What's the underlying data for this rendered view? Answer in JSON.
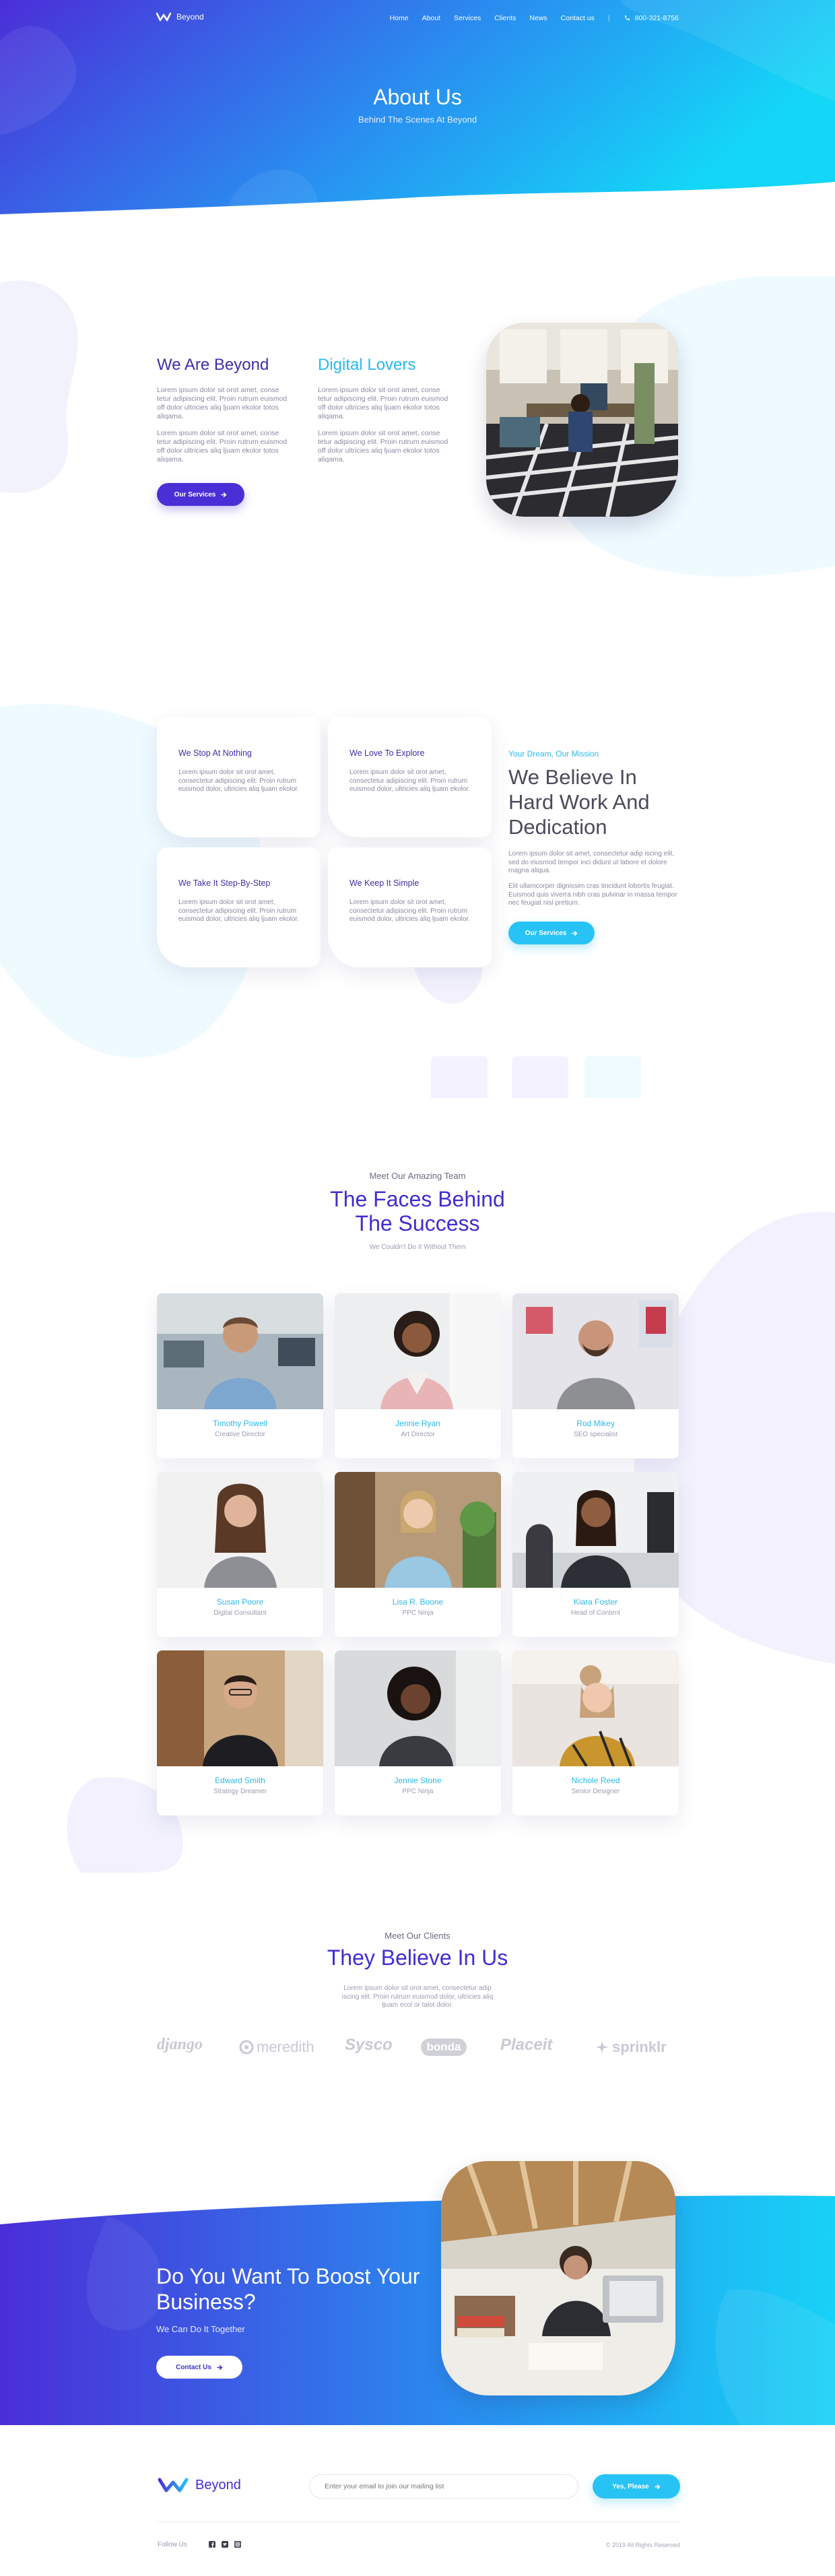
{
  "nav": {
    "logo_text": "Beyond",
    "links": [
      "Home",
      "About",
      "Services",
      "Clients",
      "News",
      "Contact us"
    ],
    "phone": "800-321-8756"
  },
  "hero": {
    "title": "About Us",
    "subtitle": "Behind The Scenes At Beyond"
  },
  "about": {
    "left_title": "We Are Beyond",
    "right_title": "Digital Lovers",
    "paragraph": "Lorem ipsum dolor sit orot amet, conse tetur adipiscing elit. Proin rutrum euismod off dolor ultricies aliq ljuam ekolor totos aliqama.",
    "button": "Our Services"
  },
  "features": {
    "cards": [
      {
        "title": "We Stop At Nothing",
        "text": "Lorem ipsum dolor sit orot amet, consectetur adipiscing elit. Proin rutrum euismod dolor, ultricies aliq ljuam ekolor."
      },
      {
        "title": "We Love To Explore",
        "text": "Lorem ipsum dolor sit orot amet, consectetur adipiscing elit. Proin rutrum euismod dolor, ultricies aliq ljuam ekolor."
      },
      {
        "title": "We Take It Step-By-Step",
        "text": "Lorem ipsum dolor sit orot amet, consectetur adipiscing elit. Proin rutrum euismod dolor, ultricies aliq ljuam ekolor."
      },
      {
        "title": "We Keep It Simple",
        "text": "Lorem ipsum dolor sit orot amet, consectetur adipiscing elit. Proin rutrum euismod dolor, ultricies aliq ljuam ekolor."
      }
    ],
    "kicker": "Your Dream, Our Mission",
    "title": "We Believe In Hard Work And Dedication",
    "paragraph1": "Lorem ipsum dolor sit amet, consectetur adip iscing elit, sed do eiusmod tempor inci didunt ut labore et dolore magna aliqua.",
    "paragraph2": "Elit ullamcorper dignissim cras tincidunt lobortis feugiat. Euismod quis viverra nibh cras pulvinar in massa tempor nec feugiat nisl pretium.",
    "button": "Our Services"
  },
  "team": {
    "kicker": "Meet Our Amazing Team",
    "title": "The Faces Behind The Success",
    "subtitle": "We Couldn't Do It Without Them",
    "members": [
      {
        "name": "Timothy Powell",
        "role": "Creative Director"
      },
      {
        "name": "Jennie Ryan",
        "role": "Art Director"
      },
      {
        "name": "Rod Mikey",
        "role": "SEO specialist"
      },
      {
        "name": "Susan Poore",
        "role": "Digital Consultant"
      },
      {
        "name": "Lisa R. Boone",
        "role": "PPC Ninja"
      },
      {
        "name": "Kiara Foster",
        "role": "Head of Content"
      },
      {
        "name": "Edward Smith",
        "role": "Strategy Dreamer"
      },
      {
        "name": "Jennie Stone",
        "role": "PPC Ninja"
      },
      {
        "name": "Nichole Reed",
        "role": "Senior Designer"
      }
    ]
  },
  "clients": {
    "kicker": "Meet Our Clients",
    "title": "They Believe In Us",
    "paragraph": "Lorem ipsum dolor sit orot amet, consectetur adip iscing elit. Proin rutrum euismod dolor, ultricies aliq ljuam ecol or talot dolor.",
    "logos": [
      "django",
      "meredith",
      "Sysco",
      "bonda",
      "Placeit",
      "sprinklr"
    ]
  },
  "cta": {
    "title": "Do You Want To Boost Your Business?",
    "subtitle": "We Can Do It Together",
    "button": "Contact Us"
  },
  "footer": {
    "logo_text": "Beyond",
    "email_placeholder": "Enter your email to join our mailing list",
    "subscribe_button": "Yes, Please",
    "follow": "Follow Us",
    "copyright": "© 2019 All Rights Reserved"
  }
}
